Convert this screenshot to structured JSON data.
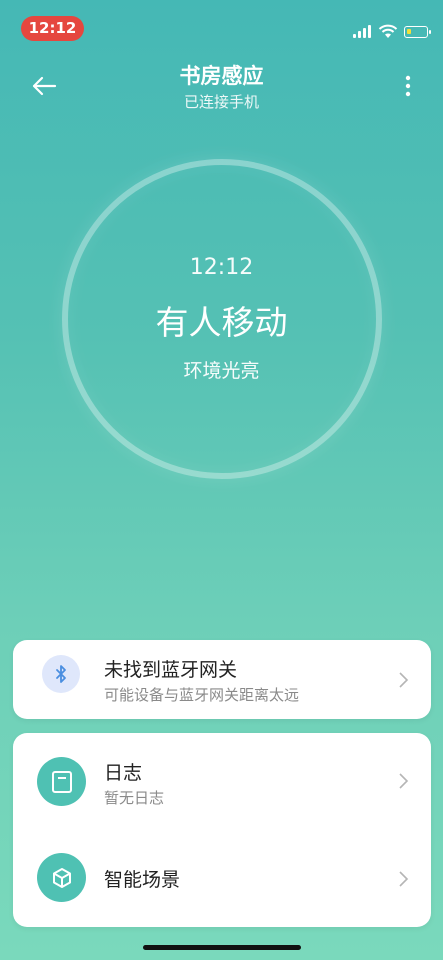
{
  "status_bar": {
    "time": "12:12"
  },
  "header": {
    "title": "书房感应",
    "subtitle": "已连接手机"
  },
  "sensor": {
    "time": "12:12",
    "status": "有人移动",
    "light": "环境光亮"
  },
  "gateway": {
    "title": "未找到蓝牙网关",
    "subtitle": "可能设备与蓝牙网关距离太远",
    "icon": "bluetooth-icon"
  },
  "menu": {
    "log": {
      "title": "日志",
      "subtitle": "暂无日志",
      "icon": "log-icon"
    },
    "scene": {
      "title": "智能场景",
      "icon": "smart-scene-icon"
    }
  },
  "colors": {
    "accent": "#4fc1b3",
    "error": "#e5473f",
    "bluetooth": "#4a8ee0"
  }
}
